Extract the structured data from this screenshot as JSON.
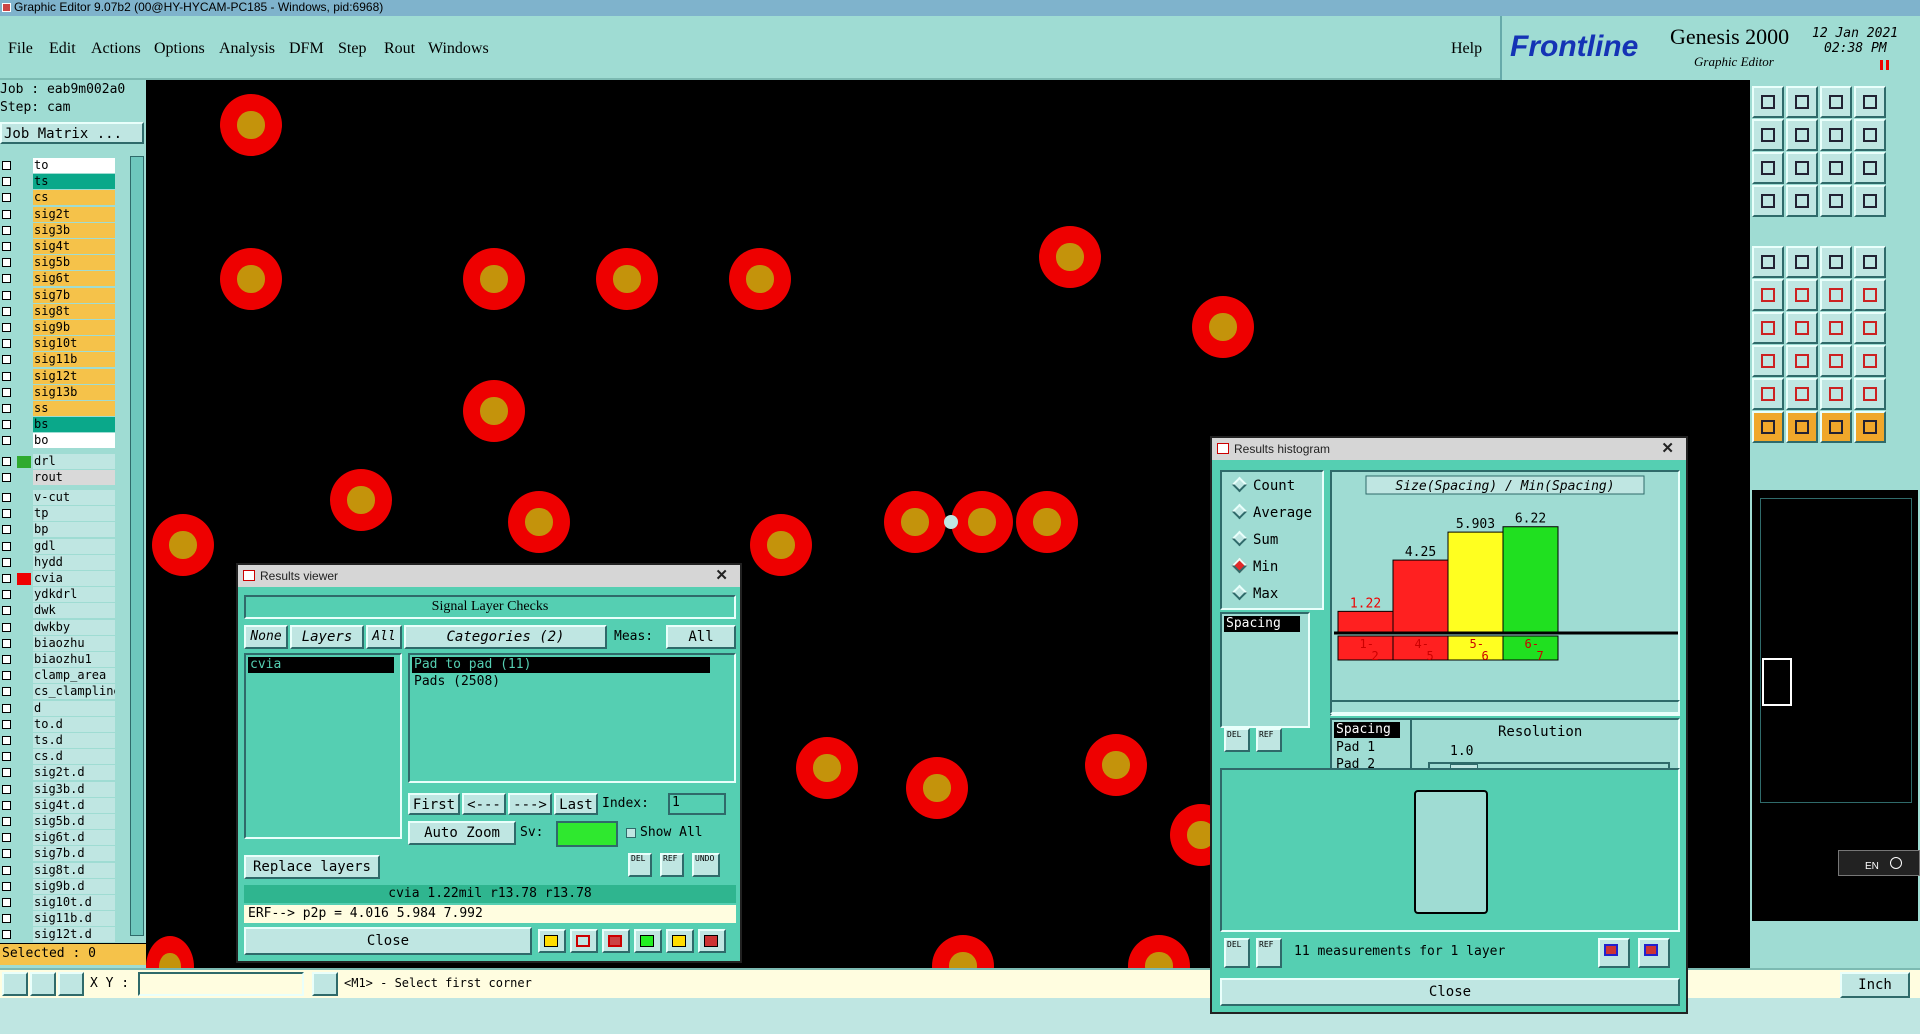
{
  "window_title": "Graphic Editor 9.07b2 (00@HY-HYCAM-PC185 - Windows, pid:6968)",
  "menu": [
    "File",
    "Edit",
    "Actions",
    "Options",
    "Analysis",
    "DFM",
    "Step",
    "Rout",
    "Windows"
  ],
  "help": "Help",
  "brand": {
    "logo": "Frontline",
    "product": "Genesis 2000",
    "subtitle": "Graphic Editor",
    "date": "12 Jan 2021",
    "time": "02:38 PM"
  },
  "job": {
    "job_line": "Job : eab9m002a0",
    "step_line": "Step: cam",
    "matrix_button": "Job Matrix ..."
  },
  "layers": [
    {
      "name": "to",
      "color": "#ffffff"
    },
    {
      "name": "ts",
      "color": "#0aa88a"
    },
    {
      "name": "cs",
      "color": "#f5c24a"
    },
    {
      "name": "sig2t",
      "color": "#f5c24a"
    },
    {
      "name": "sig3b",
      "color": "#f5c24a"
    },
    {
      "name": "sig4t",
      "color": "#f5c24a"
    },
    {
      "name": "sig5b",
      "color": "#f5c24a"
    },
    {
      "name": "sig6t",
      "color": "#f5c24a"
    },
    {
      "name": "sig7b",
      "color": "#f5c24a"
    },
    {
      "name": "sig8t",
      "color": "#f5c24a"
    },
    {
      "name": "sig9b",
      "color": "#f5c24a"
    },
    {
      "name": "sig10t",
      "color": "#f5c24a"
    },
    {
      "name": "sig11b",
      "color": "#f5c24a"
    },
    {
      "name": "sig12t",
      "color": "#f5c24a"
    },
    {
      "name": "sig13b",
      "color": "#f5c24a"
    },
    {
      "name": "ss",
      "color": "#f5c24a"
    },
    {
      "name": "bs",
      "color": "#0aa88a"
    },
    {
      "name": "bo",
      "color": "#ffffff"
    },
    {
      "name": "drl",
      "color": "#bfe6e2"
    },
    {
      "name": "rout",
      "color": "#d9d9d9"
    },
    {
      "name": "v-cut",
      "color": "#bfe6e2"
    },
    {
      "name": "tp",
      "color": "#bfe6e2"
    },
    {
      "name": "bp",
      "color": "#bfe6e2"
    },
    {
      "name": "gdl",
      "color": "#bfe6e2"
    },
    {
      "name": "hydd",
      "color": "#bfe6e2"
    },
    {
      "name": "cvia",
      "color": "#bfe6e2"
    },
    {
      "name": "ydkdrl",
      "color": "#bfe6e2"
    },
    {
      "name": "dwk",
      "color": "#bfe6e2"
    },
    {
      "name": "dwkby",
      "color": "#bfe6e2"
    },
    {
      "name": "biaozhu",
      "color": "#bfe6e2"
    },
    {
      "name": "biaozhu1",
      "color": "#bfe6e2"
    },
    {
      "name": "clamp_area",
      "color": "#bfe6e2"
    },
    {
      "name": "cs_clampline",
      "color": "#bfe6e2"
    },
    {
      "name": "d",
      "color": "#bfe6e2"
    },
    {
      "name": "to.d",
      "color": "#bfe6e2"
    },
    {
      "name": "ts.d",
      "color": "#bfe6e2"
    },
    {
      "name": "cs.d",
      "color": "#bfe6e2"
    },
    {
      "name": "sig2t.d",
      "color": "#bfe6e2"
    },
    {
      "name": "sig3b.d",
      "color": "#bfe6e2"
    },
    {
      "name": "sig4t.d",
      "color": "#bfe6e2"
    },
    {
      "name": "sig5b.d",
      "color": "#bfe6e2"
    },
    {
      "name": "sig6t.d",
      "color": "#bfe6e2"
    },
    {
      "name": "sig7b.d",
      "color": "#bfe6e2"
    },
    {
      "name": "sig8t.d",
      "color": "#bfe6e2"
    },
    {
      "name": "sig9b.d",
      "color": "#bfe6e2"
    },
    {
      "name": "sig10t.d",
      "color": "#bfe6e2"
    },
    {
      "name": "sig11b.d",
      "color": "#bfe6e2"
    },
    {
      "name": "sig12t.d",
      "color": "#bfe6e2"
    }
  ],
  "selected": "Selected : 0",
  "status": {
    "xy_label": "X Y :",
    "xy_value": "",
    "prompt": "<M1> - Select first corner",
    "units": "Inch"
  },
  "results_viewer": {
    "title": "Results viewer",
    "heading": "Signal Layer Checks",
    "none": "None",
    "layers": "Layers",
    "all": "All",
    "categories": "Categories (2)",
    "meas_label": "Meas:",
    "meas_value": "All",
    "layer_items": [
      "cvia"
    ],
    "category_items": [
      "Pad to pad (11)",
      "Pads (2508)"
    ],
    "nav": [
      "First",
      "<---",
      "--->",
      "Last"
    ],
    "index_label": "Index:",
    "index_value": "1",
    "auto_zoom": "Auto Zoom",
    "sv_label": "Sv:",
    "show_all": "Show All",
    "replace_layers": "Replace layers",
    "del": "DEL",
    "ref": "REF",
    "undo": "UNDO",
    "result_line": "cvia  1.22mil   r13.78   r13.78",
    "erf_line": "ERF--> p2p = 4.016 5.984 7.992",
    "close": "Close"
  },
  "histogram": {
    "title": "Results histogram",
    "options": [
      {
        "label": "Count",
        "selected": false
      },
      {
        "label": "Average",
        "selected": false
      },
      {
        "label": "Sum",
        "selected": false
      },
      {
        "label": "Min",
        "selected": true
      },
      {
        "label": "Max",
        "selected": false
      }
    ],
    "list_item": "Spacing",
    "chart_title": "Size(Spacing) / Min(Spacing)",
    "resolution_label": "Resolution",
    "resolution_value": "1.0",
    "spacing_items": [
      "Spacing",
      "Pad 1",
      "Pad 2"
    ],
    "del": "DEL",
    "ref": "REF",
    "measurements": "11 measurements for 1 layer",
    "close": "Close"
  },
  "chart_data": {
    "type": "bar",
    "title": "Size(Spacing) / Min(Spacing)",
    "categories": [
      "1-2",
      "4-5",
      "5-6",
      "6-7"
    ],
    "values": [
      1.22,
      4.25,
      5.903,
      6.22
    ],
    "colors": [
      "#ff2020",
      "#ff2020",
      "#ffff20",
      "#20e020"
    ],
    "ylim": [
      0,
      6.5
    ]
  },
  "lang_indicator": "EN"
}
